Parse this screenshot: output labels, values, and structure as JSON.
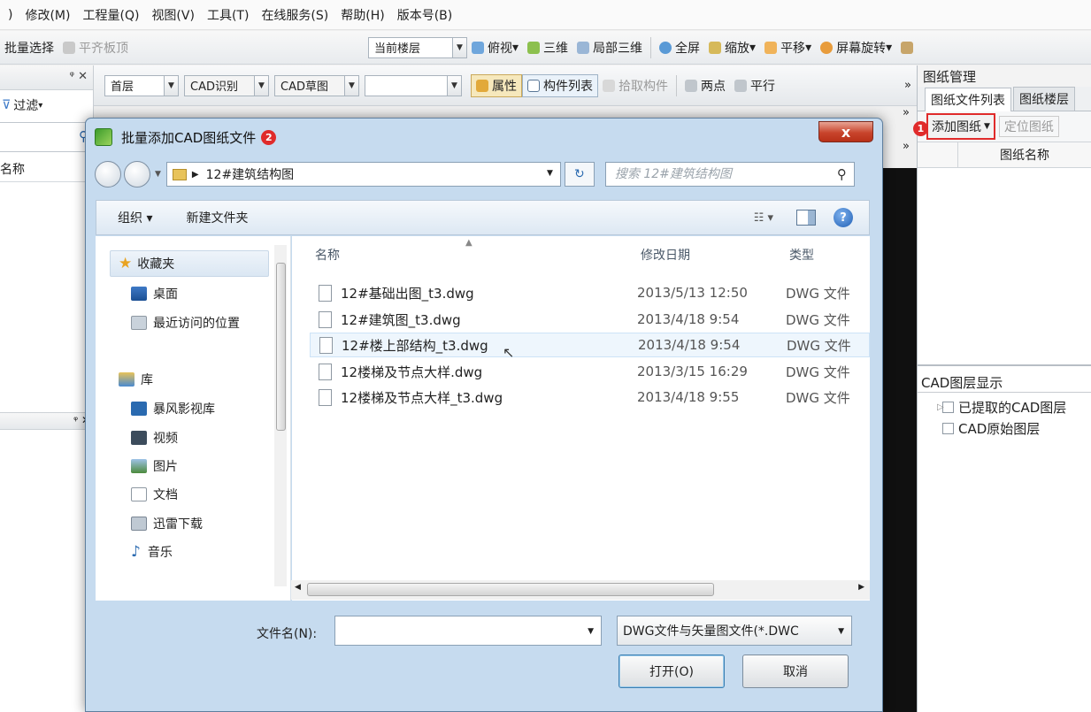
{
  "menubar": [
    "修改(M)",
    "工程量(Q)",
    "视图(V)",
    "工具(T)",
    "在线服务(S)",
    "帮助(H)",
    "版本号(B)"
  ],
  "toolbar1": {
    "left_items": [
      "批量选择",
      "平齐板顶"
    ],
    "floor_combo": "当前楼层",
    "right_items": [
      "俯视",
      "三维",
      "局部三维",
      "全屏",
      "缩放",
      "平移",
      "屏幕旋转"
    ]
  },
  "leftpanel": {
    "filter_label": "过滤",
    "col_header": "名称"
  },
  "toolbar2": {
    "floor": "首层",
    "cad_recognize": "CAD识别",
    "cad_sketch": "CAD草图",
    "properties": "属性",
    "component_list": "构件列表",
    "pick_component": "拾取构件",
    "two_points": "两点",
    "parallel": "平行"
  },
  "rightpanel": {
    "title": "图纸管理",
    "tabs": [
      "图纸文件列表",
      "图纸楼层"
    ],
    "add_drawing": "添加图纸",
    "locate_drawing": "定位图纸",
    "grid_header": "图纸名称",
    "layer_title": "CAD图层显示",
    "layers": [
      "已提取的CAD图层",
      "CAD原始图层"
    ],
    "badge": "1"
  },
  "dialog": {
    "title": "批量添加CAD图纸文件",
    "badge": "2",
    "close_label": "x",
    "path": "12#建筑结构图",
    "search_placeholder": "搜索 12#建筑结构图",
    "organize": "组织 ▾",
    "new_folder": "新建文件夹",
    "nav": {
      "favorites": "收藏夹",
      "desktop": "桌面",
      "recent": "最近访问的位置",
      "libraries": "库",
      "baofeng": "暴风影视库",
      "videos": "视频",
      "pictures": "图片",
      "documents": "文档",
      "xunlei": "迅雷下载",
      "music": "音乐"
    },
    "columns": {
      "name": "名称",
      "date": "修改日期",
      "type": "类型"
    },
    "files": [
      {
        "name": "12#基础出图_t3.dwg",
        "date": "2013/5/13 12:50",
        "type": "DWG 文件"
      },
      {
        "name": "12#建筑图_t3.dwg",
        "date": "2013/4/18 9:54",
        "type": "DWG 文件"
      },
      {
        "name": "12#楼上部结构_t3.dwg",
        "date": "2013/4/18 9:54",
        "type": "DWG 文件"
      },
      {
        "name": "12楼梯及节点大样.dwg",
        "date": "2013/3/15 16:29",
        "type": "DWG 文件"
      },
      {
        "name": "12楼梯及节点大样_t3.dwg",
        "date": "2013/4/18 9:55",
        "type": "DWG 文件"
      }
    ],
    "filename_label": "文件名(N):",
    "filename_value": "",
    "filter": "DWG文件与矢量图文件(*.DWC",
    "open": "打开(O)",
    "cancel": "取消"
  }
}
